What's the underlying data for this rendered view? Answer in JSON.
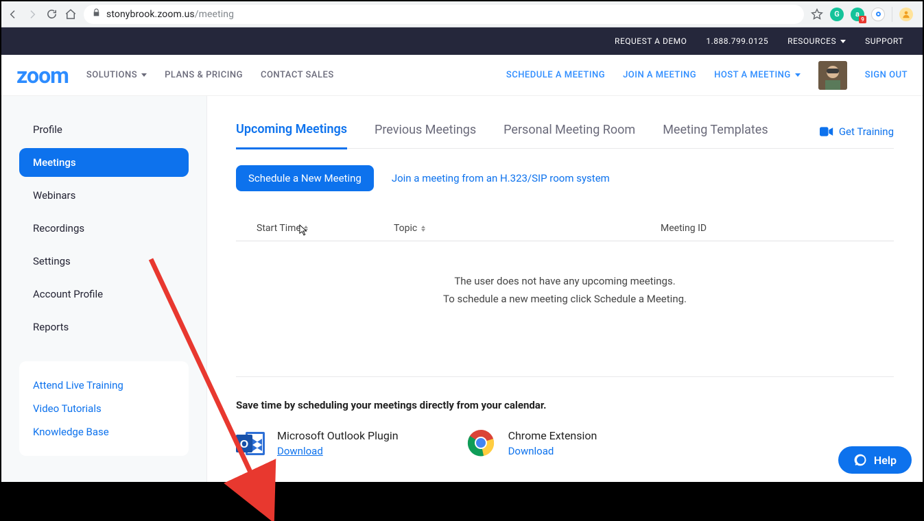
{
  "browser": {
    "url_host": "stonybrook.zoom.us",
    "url_path": "/meeting",
    "ext_badge": "9"
  },
  "topbar": {
    "demo": "REQUEST A DEMO",
    "phone": "1.888.799.0125",
    "resources": "RESOURCES",
    "support": "SUPPORT"
  },
  "header": {
    "logo": "zoom",
    "nav_left": [
      "SOLUTIONS",
      "PLANS & PRICING",
      "CONTACT SALES"
    ],
    "nav_right": {
      "schedule": "SCHEDULE A MEETING",
      "join": "JOIN A MEETING",
      "host": "HOST A MEETING",
      "signout": "SIGN OUT"
    }
  },
  "sidebar": {
    "items": [
      "Profile",
      "Meetings",
      "Webinars",
      "Recordings",
      "Settings",
      "Account Profile",
      "Reports"
    ],
    "active_index": 1,
    "help_links": [
      "Attend Live Training",
      "Video Tutorials",
      "Knowledge Base"
    ]
  },
  "main": {
    "tabs": [
      "Upcoming Meetings",
      "Previous Meetings",
      "Personal Meeting Room",
      "Meeting Templates"
    ],
    "active_tab": 0,
    "training": "Get Training",
    "schedule_btn": "Schedule a New Meeting",
    "join_sip": "Join a meeting from an H.323/SIP room system",
    "columns": {
      "start": "Start Time",
      "topic": "Topic",
      "id": "Meeting ID"
    },
    "empty1": "The user does not have any upcoming meetings.",
    "empty2": "To schedule a new meeting click Schedule a Meeting."
  },
  "footer": {
    "title": "Save time by scheduling your meetings directly from your calendar.",
    "outlook": {
      "name": "Microsoft Outlook Plugin",
      "download": "Download"
    },
    "chrome": {
      "name": "Chrome Extension",
      "download": "Download"
    }
  },
  "help_bubble": "Help"
}
